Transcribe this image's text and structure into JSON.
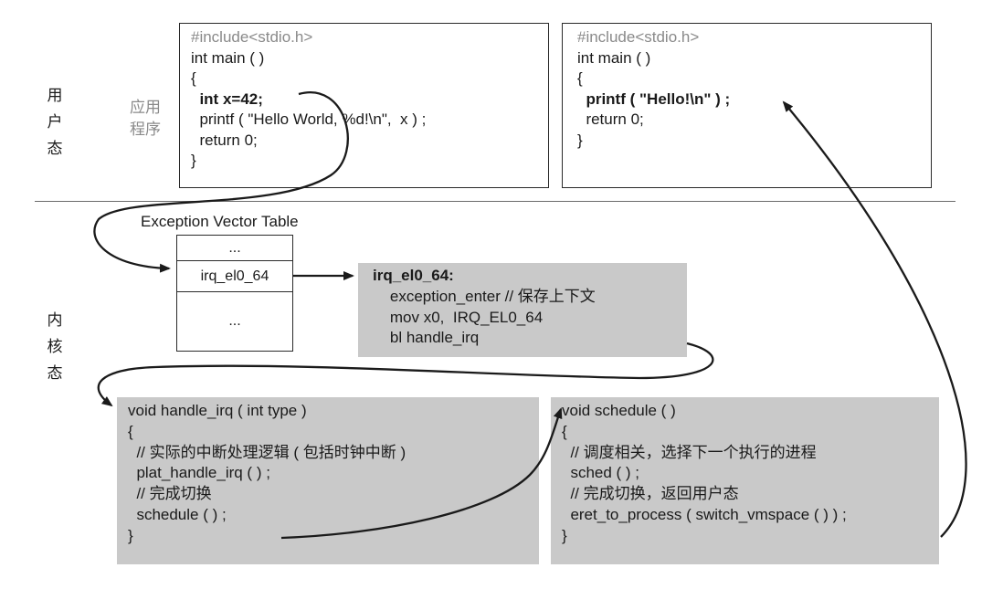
{
  "layers": {
    "user": [
      "用",
      "户",
      "态"
    ],
    "kernel": [
      "内",
      "核",
      "态"
    ],
    "app": [
      "应用",
      "程序"
    ]
  },
  "user_left": {
    "lines": [
      "#include<stdio.h>",
      "int main ( )",
      "{",
      "  int x=42;",
      "  printf ( \"Hello World, %d!\\n\",  x ) ;",
      "  return 0;",
      "}"
    ]
  },
  "user_right": {
    "lines": [
      "#include<stdio.h>",
      "int main ( )",
      "{",
      "  printf ( \"Hello!\\n\" ) ;",
      "  return 0;",
      "}"
    ]
  },
  "vector_table": {
    "title": "Exception Vector Table",
    "cells": [
      "...",
      "irq_el0_64",
      "..."
    ]
  },
  "irq_handler": {
    "lines": [
      "irq_el0_64:",
      "    exception_enter // 保存上下文",
      "    mov x0,  IRQ_EL0_64",
      "    bl handle_irq"
    ]
  },
  "handle_irq": {
    "lines": [
      "void handle_irq ( int type )",
      "{",
      "  // 实际的中断处理逻辑 ( 包括时钟中断 )",
      "  plat_handle_irq ( ) ;",
      "  // 完成切换",
      "  schedule ( ) ;",
      "}"
    ]
  },
  "schedule": {
    "lines": [
      "void schedule ( )",
      "{",
      "  // 调度相关，选择下一个执行的进程",
      "  sched ( ) ;",
      "  // 完成切换，返回用户态",
      "  eret_to_process ( switch_vmspace ( ) ) ;",
      "}"
    ]
  },
  "colors": {
    "shade": "#c9c9c9",
    "border": "#2a2a2a",
    "arrow": "#1a1a1a",
    "muted": "#8a8a8a"
  }
}
